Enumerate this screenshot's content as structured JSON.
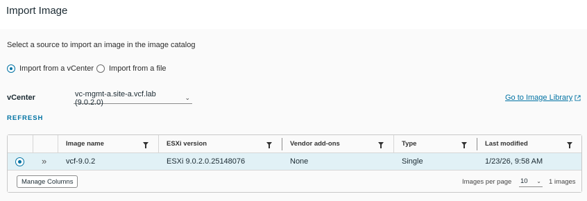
{
  "page": {
    "title": "Import Image"
  },
  "source": {
    "prompt": "Select a source to import an image in the image catalog",
    "options": [
      {
        "label": "Import from a vCenter",
        "checked": true
      },
      {
        "label": "Import from a file",
        "checked": false
      }
    ]
  },
  "vcenter": {
    "label": "vCenter",
    "selected": "vc-mgmt-a.site-a.vcf.lab (9.0.2.0)",
    "library_link": "Go to Image Library"
  },
  "actions": {
    "refresh": "REFRESH"
  },
  "grid": {
    "columns": [
      "Image name",
      "ESXi version",
      "Vendor add-ons",
      "Type",
      "Last modified"
    ],
    "rows": [
      {
        "selected": true,
        "image_name": "vcf-9.0.2",
        "esxi_version": "ESXi 9.0.2.0.25148076",
        "vendor_addons": "None",
        "type": "Single",
        "last_modified": "1/23/26, 9:58 AM"
      }
    ],
    "footer": {
      "manage_columns": "Manage Columns",
      "per_page_label": "Images per page",
      "per_page_value": "10",
      "count": "1 images"
    }
  },
  "colors": {
    "accent": "#0072a3",
    "row_selected": "#e1f1f6"
  }
}
